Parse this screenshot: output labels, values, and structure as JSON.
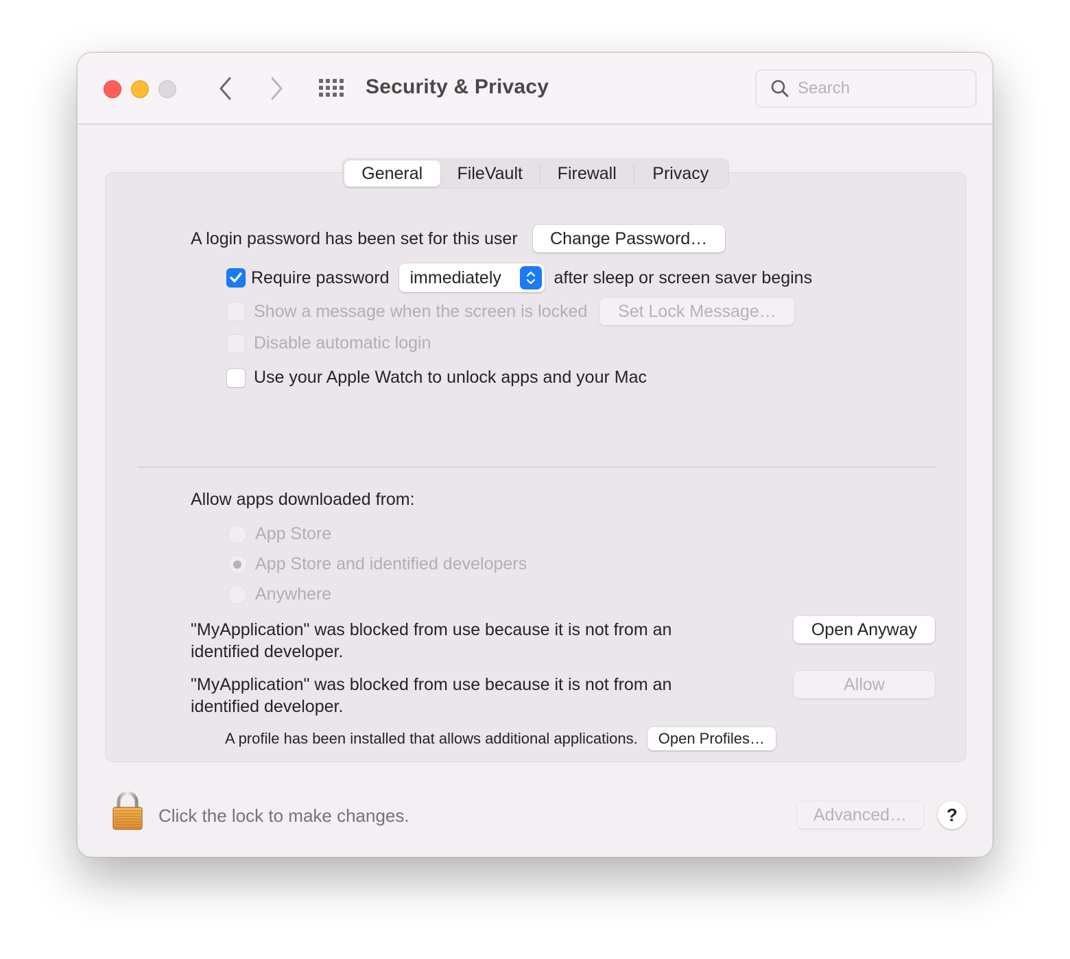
{
  "window": {
    "title": "Security & Privacy",
    "search_placeholder": "Search",
    "search_value": ""
  },
  "icons": {
    "back": "chevron-left-icon",
    "forward": "chevron-right-icon",
    "show_all": "grid-icon",
    "search": "magnifying-glass-icon",
    "lock": "padlock-icon",
    "help": "question-mark-icon"
  },
  "tabs": [
    {
      "label": "General",
      "active": true
    },
    {
      "label": "FileVault",
      "active": false
    },
    {
      "label": "Firewall",
      "active": false
    },
    {
      "label": "Privacy",
      "active": false
    }
  ],
  "general": {
    "login_password_text": "A login password has been set for this user",
    "change_password_button": "Change Password…",
    "require_password": {
      "label": "Require password",
      "checked": true,
      "popup_value": "immediately",
      "suffix": "after sleep or screen saver begins"
    },
    "show_message": {
      "label": "Show a message when the screen is locked",
      "checked": false,
      "enabled": false,
      "button": "Set Lock Message…"
    },
    "disable_auto_login": {
      "label": "Disable automatic login",
      "checked": false,
      "enabled": false
    },
    "apple_watch": {
      "label": "Use your Apple Watch to unlock apps and your Mac",
      "checked": false,
      "enabled": true
    },
    "allow_apps": {
      "heading": "Allow apps downloaded from:",
      "options": [
        {
          "label": "App Store",
          "selected": false
        },
        {
          "label": "App Store and identified developers",
          "selected": true
        },
        {
          "label": "Anywhere",
          "selected": false
        }
      ]
    },
    "blocked_1": {
      "text": "\"MyApplication\" was blocked from use because it is not from an identified developer.",
      "button": "Open Anyway"
    },
    "blocked_2": {
      "text": "\"MyApplication\" was blocked from use because it is not from an identified developer.",
      "button": "Allow"
    },
    "profile": {
      "text": "A profile has been installed that allows additional applications.",
      "button": "Open Profiles…"
    }
  },
  "footer": {
    "lock_text": "Click the lock to make changes.",
    "advanced_button": "Advanced…",
    "help_label": "?"
  },
  "colors": {
    "accent": "#1a7cf5",
    "close": "#fe5f57",
    "minimize": "#febc2e",
    "zoom_disabled": "#dcd8dc"
  }
}
